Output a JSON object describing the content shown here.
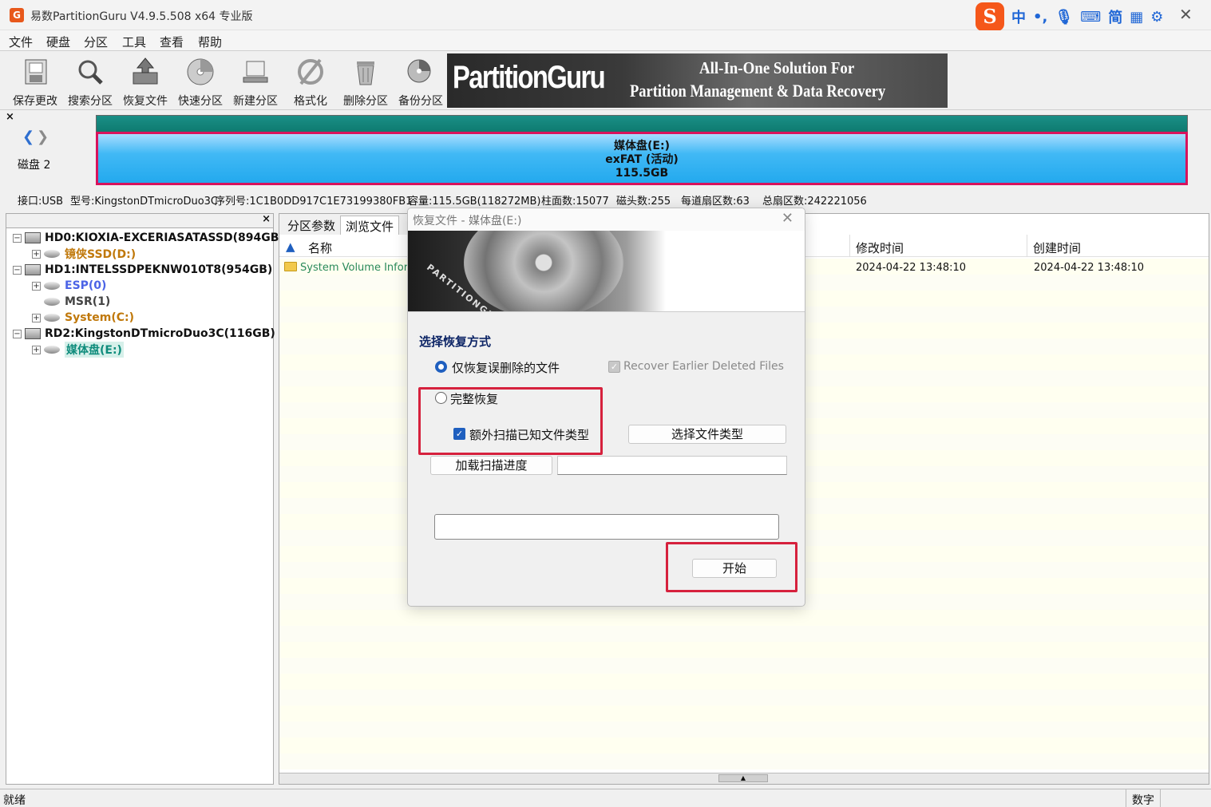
{
  "window": {
    "title": "易数PartitionGuru V4.9.5.508 x64 专业版",
    "app_icon": "G"
  },
  "ime": {
    "logo": "S",
    "items": [
      "中",
      "•,",
      "mic-icon",
      "keyboard-icon",
      "简",
      "grid-icon",
      "settings-icon"
    ],
    "labels": {
      "zh": "中",
      "punct": "•,",
      "jian": "简"
    }
  },
  "menu": {
    "items": [
      "文件",
      "硬盘",
      "分区",
      "工具",
      "查看",
      "帮助"
    ]
  },
  "toolbar": {
    "buttons": [
      "保存更改",
      "搜索分区",
      "恢复文件",
      "快速分区",
      "新建分区",
      "格式化",
      "删除分区",
      "备份分区"
    ]
  },
  "banner": {
    "logo": "PartitionGuru",
    "line1": "All-In-One Solution For",
    "line2": "Partition Management & Data Recovery"
  },
  "disk": {
    "close": "×",
    "label": "磁盘 2",
    "partition_name": "媒体盘(E:)",
    "partition_fs": "exFAT (活动)",
    "partition_size": "115.5GB"
  },
  "info": {
    "interface": "接口:USB",
    "model": "型号:KingstonDTmicroDuo3C",
    "serial": "序列号:1C1B0DD917C1E73199380FB1",
    "capacity": "容量:115.5GB(118272MB)",
    "cylinders": "柱面数:15077",
    "heads": "磁头数:255",
    "sectors_per_track": "每道扇区数:63",
    "total_sectors": "总扇区数:242221056"
  },
  "tree": {
    "close": "×",
    "nodes": [
      {
        "label": "HD0:KIOXIA-EXCERIASATASSD(894GB)"
      },
      {
        "label": "镜侠SSD(D:)"
      },
      {
        "label": "HD1:INTELSSDPEKNW010T8(954GB)"
      },
      {
        "label": "ESP(0)"
      },
      {
        "label": "MSR(1)"
      },
      {
        "label": "System(C:)"
      },
      {
        "label": "RD2:KingstonDTmicroDuo3C(116GB)"
      },
      {
        "label": "媒体盘(E:)"
      }
    ]
  },
  "tabs": [
    "分区参数",
    "浏览文件"
  ],
  "files": {
    "columns": {
      "name": "名称",
      "modified": "修改时间",
      "created": "创建时间"
    },
    "rows": [
      {
        "name": "System Volume Inform",
        "modified": "2024-04-22 13:48:10",
        "created": "2024-04-22 13:48:10"
      }
    ]
  },
  "status": {
    "left": "就绪",
    "right": "数字"
  },
  "dialog": {
    "title": "恢复文件 - 媒体盘(E:)",
    "banner_brand": "PARTITIONGURU",
    "section": "选择恢复方式",
    "option_deleted": "仅恢复误删除的文件",
    "option_earlier": "Recover Earlier Deleted Files",
    "option_full": "完整恢复",
    "option_extra_scan": "额外扫描已知文件类型",
    "btn_select_types": "选择文件类型",
    "btn_load_progress": "加载扫描进度",
    "load_path": "",
    "btn_start": "开始",
    "selected_option": "option_deleted",
    "extra_scan_checked": true,
    "earlier_checked": true,
    "earlier_enabled": false
  },
  "colors": {
    "accent": "#1f5fbf",
    "highlight": "#d6213d",
    "partition": "#23a9ee",
    "partition_border": "#d8125c",
    "disk_top": "#0e7b70"
  }
}
